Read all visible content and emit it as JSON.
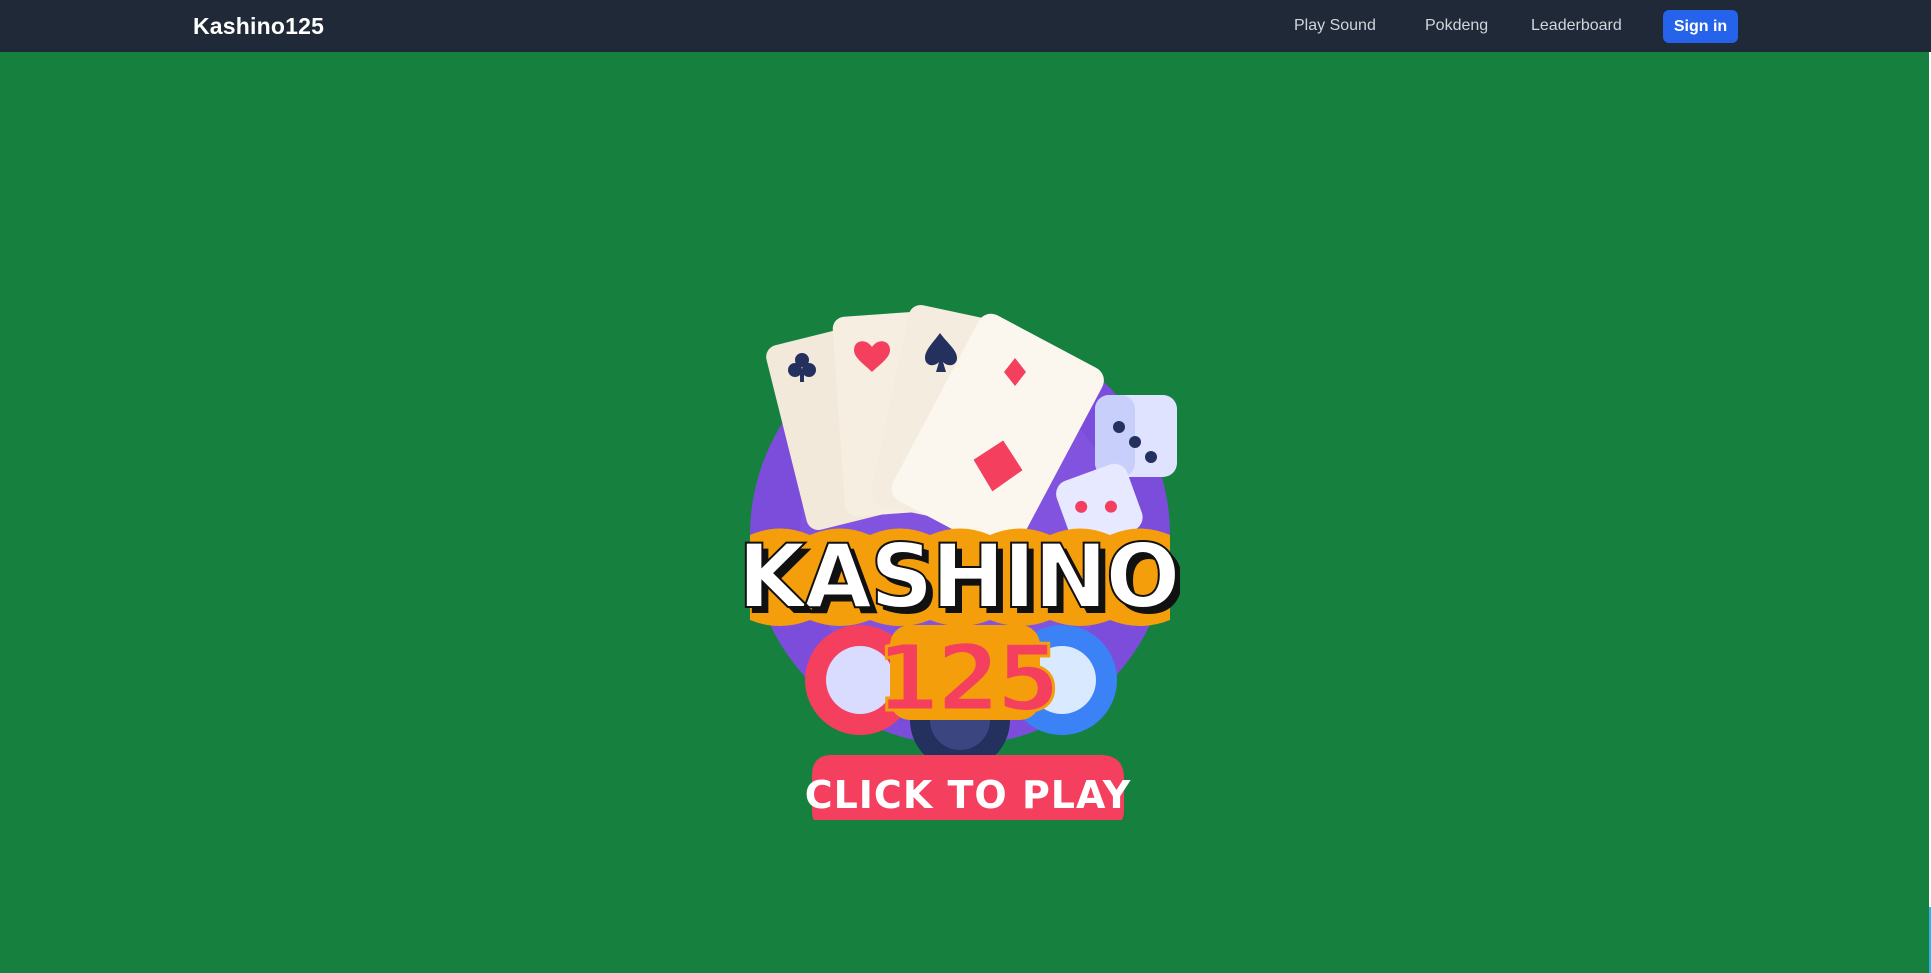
{
  "navbar": {
    "brand": "Kashino125",
    "links": [
      "Play Sound",
      "Pokdeng",
      "Leaderboard"
    ],
    "signin_label": "Sign in"
  },
  "logo": {
    "wordmark": "KASHINO",
    "number": "125",
    "cta": "CLICK TO PLAY"
  },
  "colors": {
    "navbar_bg": "#1f2937",
    "table_green": "#16813f",
    "signin_blue": "#2563eb",
    "logo_red": "#f43f5e",
    "logo_orange": "#f59e0b",
    "logo_purple": "#7c4ddb"
  },
  "icons": [
    "club-icon",
    "heart-icon",
    "spade-icon",
    "diamond-icon",
    "dice-icon",
    "poker-chip-icon"
  ]
}
